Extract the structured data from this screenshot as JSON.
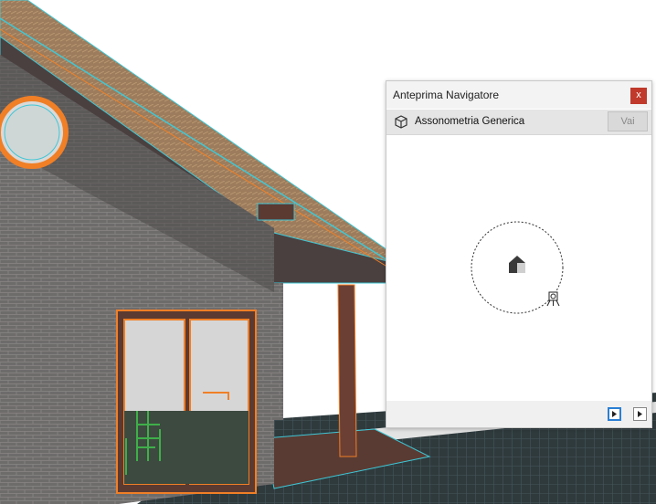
{
  "navigator_preview": {
    "title": "Anteprima Navigatore",
    "close_label": "x",
    "view_name": "Assonometria Generica",
    "go_label": "Vai",
    "view_icon": "cube-icon",
    "footer": {
      "play_icon": "play-icon",
      "next_icon": "next-icon"
    }
  },
  "scene": {
    "description_icons": [
      "house-3d-model"
    ],
    "colors": {
      "brick": "#6e6b6b",
      "selection": "#f07f26",
      "edges": "#3fc7d6",
      "ground": "#2f3a3d",
      "furniture": "#3faf4a"
    }
  }
}
